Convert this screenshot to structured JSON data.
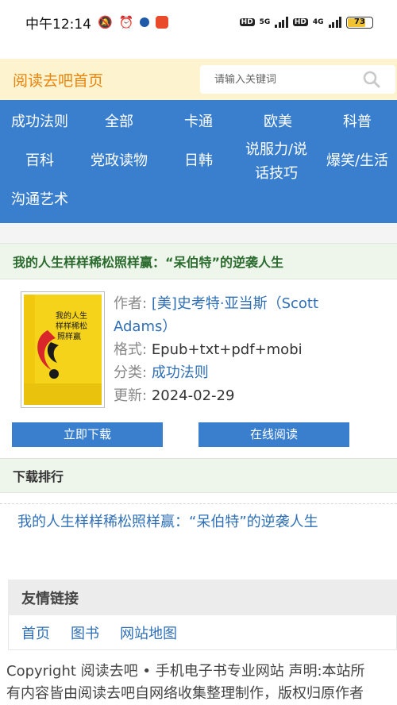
{
  "status_bar": {
    "time": "中午12:14",
    "battery": "73",
    "net1": "5G",
    "net2": "4G",
    "hd": "HD"
  },
  "header": {
    "logo": "阅读去吧首页",
    "search_placeholder": "请输入关键词"
  },
  "nav": [
    "成功法则",
    "全部",
    "卡通",
    "欧美",
    "科普",
    "百科",
    "党政读物",
    "日韩",
    "说服力/说话技巧",
    "爆笑/生活",
    "沟通艺术"
  ],
  "book": {
    "title": "我的人生样样稀松照样赢：“呆伯特”的逆袭人生",
    "author_label": "作者:",
    "author": "[美]史考特·亚当斯（Scott Adams）",
    "format_label": "格式:",
    "format": "Epub+txt+pdf+mobi",
    "category_label": "分类:",
    "category": "成功法则",
    "updated_label": "更新:",
    "updated": "2024-02-29",
    "cover_text": "我的人生样样稀松照样赢",
    "download_button": "立即下载",
    "read_button": "在线阅读"
  },
  "ranking": {
    "heading": "下载排行",
    "items": [
      "我的人生样样稀松照样赢：“呆伯特”的逆袭人生"
    ]
  },
  "friends": {
    "heading": "友情链接",
    "links": [
      "首页",
      "图书",
      "网站地图"
    ]
  },
  "footer": {
    "line1": "Copyright 阅读去吧 • 手机电子书专业网站 声明:本站所",
    "line2": "有内容皆由阅读去吧自网络收集整理制作，版权归原作者"
  },
  "colors": {
    "nav_bg": "#3a7fcd",
    "header_bg": "#fdf3cf",
    "logo": "#e8840c",
    "link": "#2f6fb6",
    "section_bg": "#eef6ec",
    "title_green": "#2b6b2e"
  }
}
